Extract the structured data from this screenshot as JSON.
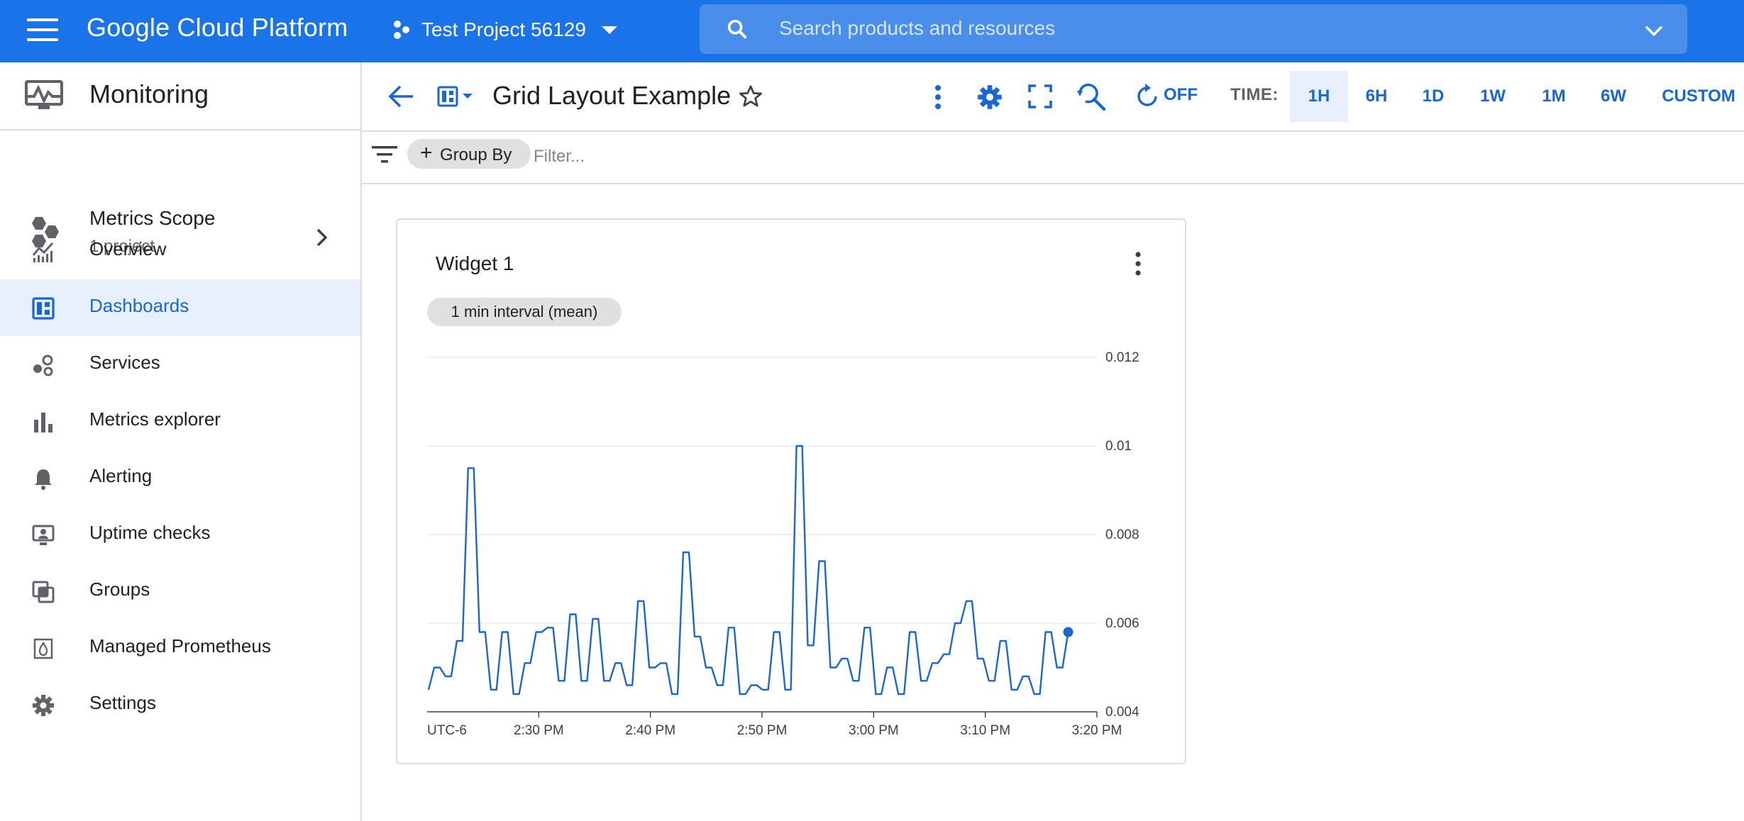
{
  "topbar": {
    "brand": "Google Cloud Platform",
    "project": "Test Project 56129",
    "search_placeholder": "Search products and resources"
  },
  "sidebar": {
    "title": "Monitoring",
    "scope_title": "Metrics Scope",
    "scope_sub": "1 project",
    "items": [
      {
        "label": "Overview",
        "icon": "overview-icon"
      },
      {
        "label": "Dashboards",
        "icon": "dashboards-icon",
        "active": true
      },
      {
        "label": "Services",
        "icon": "services-icon"
      },
      {
        "label": "Metrics explorer",
        "icon": "bar-chart-icon"
      },
      {
        "label": "Alerting",
        "icon": "bell-icon"
      },
      {
        "label": "Uptime checks",
        "icon": "uptime-icon"
      },
      {
        "label": "Groups",
        "icon": "groups-icon"
      },
      {
        "label": "Managed Prometheus",
        "icon": "prometheus-icon"
      },
      {
        "label": "Settings",
        "icon": "gear-icon"
      }
    ]
  },
  "header": {
    "dashboard_title": "Grid Layout Example",
    "refresh_label": "OFF",
    "time_label": "TIME:",
    "time_options": [
      "1H",
      "6H",
      "1D",
      "1W",
      "1M",
      "6W",
      "CUSTOM"
    ],
    "selected_time": "1H"
  },
  "filterbar": {
    "group_by": "Group By",
    "filter_placeholder": "Filter..."
  },
  "widget": {
    "title": "Widget 1",
    "interval_chip": "1 min interval (mean)"
  },
  "colors": {
    "brand": "#1a73e8",
    "series": "#1a66d2",
    "active_bg": "#e8f0fe"
  },
  "chart_data": {
    "type": "line",
    "timezone_label": "UTC-6",
    "x_tick_labels": [
      "2:30 PM",
      "2:40 PM",
      "2:50 PM",
      "3:00 PM",
      "3:10 PM",
      "3:20 PM"
    ],
    "y_tick_labels": [
      "0.012",
      "0.01",
      "0.008",
      "0.006",
      "0.004"
    ],
    "ylim": [
      0.004,
      0.012
    ],
    "x_start_time": "2:20 PM",
    "x_end_time": "3:20 PM",
    "series": [
      {
        "values": [
          0.0045,
          0.005,
          0.005,
          0.0048,
          0.0048,
          0.0056,
          0.0056,
          0.0095,
          0.0095,
          0.0058,
          0.0058,
          0.0045,
          0.0045,
          0.0058,
          0.0058,
          0.0044,
          0.0044,
          0.0051,
          0.0051,
          0.0058,
          0.0058,
          0.0059,
          0.0059,
          0.0047,
          0.0047,
          0.0062,
          0.0062,
          0.0047,
          0.0047,
          0.0061,
          0.0061,
          0.0047,
          0.0047,
          0.0051,
          0.0051,
          0.0046,
          0.0046,
          0.0065,
          0.0065,
          0.005,
          0.005,
          0.0051,
          0.0051,
          0.0044,
          0.0044,
          0.0076,
          0.0076,
          0.0057,
          0.0057,
          0.005,
          0.005,
          0.0046,
          0.0046,
          0.0059,
          0.0059,
          0.0044,
          0.0044,
          0.0046,
          0.0046,
          0.0045,
          0.0045,
          0.0058,
          0.0058,
          0.0045,
          0.0045,
          0.01,
          0.01,
          0.0055,
          0.0055,
          0.0074,
          0.0074,
          0.005,
          0.005,
          0.0052,
          0.0052,
          0.0047,
          0.0047,
          0.0059,
          0.0059,
          0.0044,
          0.0044,
          0.005,
          0.005,
          0.0044,
          0.0044,
          0.0058,
          0.0058,
          0.0047,
          0.0047,
          0.0051,
          0.0051,
          0.0053,
          0.0053,
          0.006,
          0.006,
          0.0065,
          0.0065,
          0.0052,
          0.0052,
          0.0047,
          0.0047,
          0.0056,
          0.0056,
          0.0045,
          0.0045,
          0.0048,
          0.0048,
          0.0044,
          0.0044,
          0.0058,
          0.0058,
          0.005,
          0.005,
          0.0058
        ],
        "last_point_marker": true
      }
    ]
  }
}
